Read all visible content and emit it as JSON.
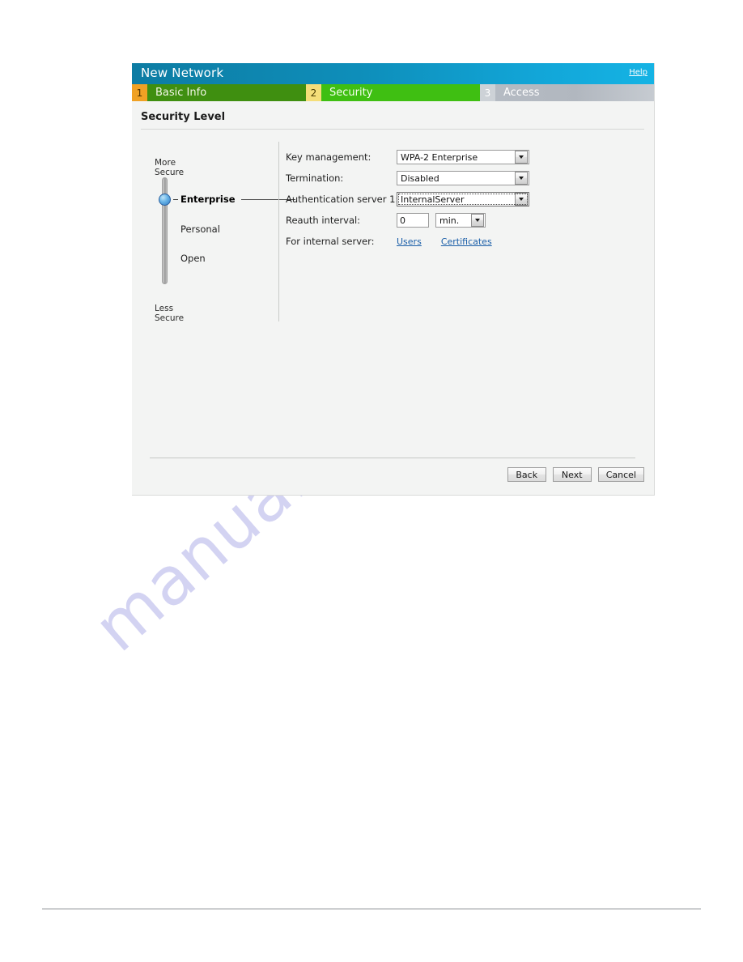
{
  "window": {
    "title": "New Network",
    "help_label": "Help"
  },
  "steps": [
    {
      "number": "1",
      "label": "Basic Info",
      "state": "completed"
    },
    {
      "number": "2",
      "label": "Security",
      "state": "active"
    },
    {
      "number": "3",
      "label": "Access",
      "state": "inactive"
    }
  ],
  "section": {
    "title": "Security Level"
  },
  "security_slider": {
    "top_caption": "More\nSecure",
    "bottom_caption": "Less\nSecure",
    "levels": [
      {
        "label": "Enterprise",
        "selected": true
      },
      {
        "label": "Personal",
        "selected": false
      },
      {
        "label": "Open",
        "selected": false
      }
    ],
    "selected_level": "Enterprise"
  },
  "form": {
    "key_management": {
      "label": "Key management:",
      "value": "WPA-2 Enterprise"
    },
    "termination": {
      "label": "Termination:",
      "value": "Disabled"
    },
    "auth_server_1": {
      "label": "Authentication server 1:",
      "value": "InternalServer",
      "focused": true
    },
    "reauth_interval": {
      "label": "Reauth interval:",
      "value": "0",
      "unit": "min."
    },
    "internal_server": {
      "label": "For internal server:",
      "users_link": "Users",
      "certificates_link": "Certificates"
    }
  },
  "footer": {
    "back_label": "Back",
    "next_label": "Next",
    "cancel_label": "Cancel"
  },
  "watermark": {
    "text": "manualshive.com"
  },
  "colors": {
    "titlebar_left": "#0d7ca3",
    "titlebar_right": "#15b3e4",
    "step_completed": "#3f8f10",
    "step_completed_badge": "#f0a124",
    "step_active": "#3fbf12",
    "step_active_badge": "#f5de79",
    "step_inactive": "#b6bcc4",
    "link": "#1a5ea8",
    "panel_bg": "#f3f4f3",
    "watermark": "#ccccf0"
  }
}
